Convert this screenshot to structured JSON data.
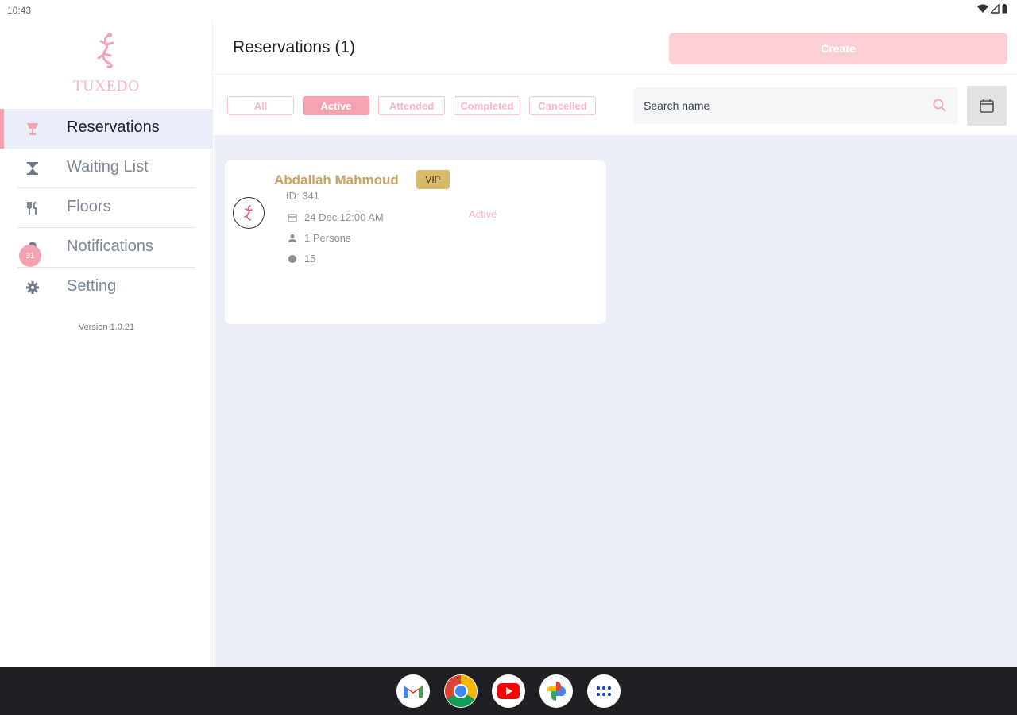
{
  "status_bar": {
    "time": "10:43"
  },
  "app": {
    "logo_text": "TUXEDO",
    "version": "Version 1.0.21"
  },
  "sidebar": {
    "items": [
      {
        "label": "Reservations",
        "icon": "reservation-icon"
      },
      {
        "label": "Waiting List",
        "icon": "hourglass-icon"
      },
      {
        "label": "Floors",
        "icon": "cutlery-icon"
      },
      {
        "label": "Notifications",
        "icon": "bell-icon",
        "badge": "31"
      },
      {
        "label": "Setting",
        "icon": "gear-icon"
      }
    ]
  },
  "header": {
    "title": "Reservations (1)",
    "create_label": "Create"
  },
  "filters": {
    "chips": [
      "All",
      "Active",
      "Attended",
      "Completed",
      "Cancelled"
    ],
    "selected": "Active"
  },
  "search": {
    "placeholder": "Search name"
  },
  "reservations": [
    {
      "name": "Abdallah Mahmoud",
      "badge": "VIP",
      "id": "ID: 341",
      "date": "24 Dec 12:00 AM",
      "persons": "1 Persons",
      "table": "15",
      "status": "Active"
    }
  ],
  "colors": {
    "accent": "#f5a3b1",
    "gold": "#c9a35f",
    "content_bg": "#ebeff8"
  }
}
